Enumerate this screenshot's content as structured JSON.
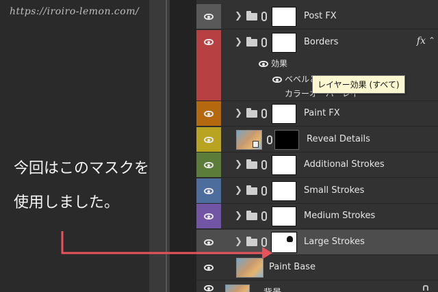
{
  "watermark": "https://iroiro-lemon.com/",
  "caption": {
    "line1": "今回はこのマスクを",
    "line2": "使用しました。"
  },
  "colors": {
    "arrow": "#e8525a",
    "borders_tag": "#b74043",
    "paintfx_tag": "#b5690f",
    "reveal_tag": "#b8a420",
    "additional_tag": "#5c7d39",
    "small_tag": "#4d6d9c",
    "medium_tag": "#7355a5"
  },
  "layers": [
    {
      "name": "Post FX",
      "tag": "none"
    },
    {
      "name": "Borders",
      "tag": "red",
      "fx": "fx"
    },
    {
      "name": "Paint FX",
      "tag": "orange"
    },
    {
      "name": "Reveal Details",
      "tag": "yellow"
    },
    {
      "name": "Additional Strokes",
      "tag": "green"
    },
    {
      "name": "Small Strokes",
      "tag": "blue"
    },
    {
      "name": "Medium Strokes",
      "tag": "violet"
    },
    {
      "name": "Large Strokes",
      "tag": "none",
      "selected": true
    },
    {
      "name": "Paint Base",
      "tag": "none"
    },
    {
      "name": "背景",
      "tag": "none"
    }
  ],
  "effects": {
    "label": "効果",
    "bevel": "ベベルとエンボス",
    "overlay": "カラーオーバーレイ"
  },
  "tooltip": "レイヤー効果 (すべて)"
}
